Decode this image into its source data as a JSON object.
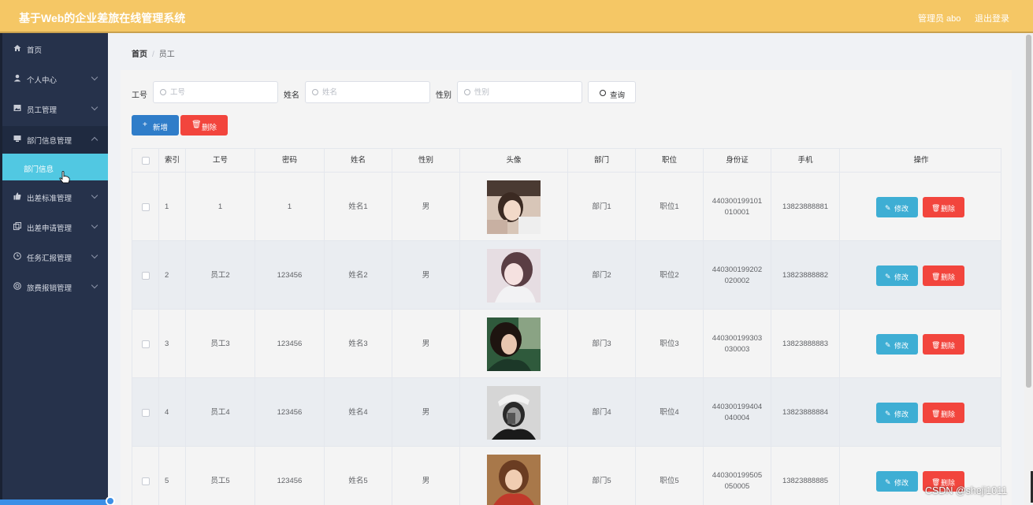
{
  "header": {
    "title": "基于Web的企业差旅在线管理系统",
    "user": "管理员 abo",
    "logout": "退出登录"
  },
  "sidebar": {
    "items": [
      {
        "label": "首页",
        "icon": "home-icon"
      },
      {
        "label": "个人中心",
        "icon": "user-icon"
      },
      {
        "label": "员工管理",
        "icon": "image-icon"
      },
      {
        "label": "部门信息管理",
        "icon": "monitor-icon"
      },
      {
        "label": "出差标准管理",
        "icon": "thumb-icon"
      },
      {
        "label": "出差申请管理",
        "icon": "copy-icon"
      },
      {
        "label": "任务汇报管理",
        "icon": "clock-icon"
      },
      {
        "label": "旅费报销管理",
        "icon": "circle-icon"
      }
    ],
    "active_sub": "部门信息"
  },
  "breadcrumb": {
    "home": "首页",
    "separator": "/",
    "current": "员工"
  },
  "search": {
    "job_no_label": "工号",
    "job_no_placeholder": "工号",
    "name_label": "姓名",
    "name_placeholder": "姓名",
    "gender_label": "性别",
    "gender_placeholder": "性别",
    "button": "查询"
  },
  "actions": {
    "add": "新增",
    "delete": "删除"
  },
  "table": {
    "columns": [
      "索引",
      "工号",
      "密码",
      "姓名",
      "性别",
      "头像",
      "部门",
      "职位",
      "身份证",
      "手机",
      "操作"
    ],
    "rows": [
      {
        "index": "1",
        "job_no": "1",
        "password": "1",
        "name": "姓名1",
        "gender": "男",
        "dept": "部门1",
        "position": "职位1",
        "id_line1": "440300199101",
        "id_line2": "010001",
        "phone": "13823888881"
      },
      {
        "index": "2",
        "job_no": "员工2",
        "password": "123456",
        "name": "姓名2",
        "gender": "男",
        "dept": "部门2",
        "position": "职位2",
        "id_line1": "440300199202",
        "id_line2": "020002",
        "phone": "13823888882"
      },
      {
        "index": "3",
        "job_no": "员工3",
        "password": "123456",
        "name": "姓名3",
        "gender": "男",
        "dept": "部门3",
        "position": "职位3",
        "id_line1": "440300199303",
        "id_line2": "030003",
        "phone": "13823888883"
      },
      {
        "index": "4",
        "job_no": "员工4",
        "password": "123456",
        "name": "姓名4",
        "gender": "男",
        "dept": "部门4",
        "position": "职位4",
        "id_line1": "440300199404",
        "id_line2": "040004",
        "phone": "13823888884"
      },
      {
        "index": "5",
        "job_no": "员工5",
        "password": "123456",
        "name": "姓名5",
        "gender": "男",
        "dept": "部门5",
        "position": "职位5",
        "id_line1": "440300199505",
        "id_line2": "050005",
        "phone": "13823888885"
      }
    ],
    "edit_label": "修改",
    "delete_label": "删除"
  },
  "watermark": "CSDN @sheji1011",
  "colors": {
    "header": "#f5c765",
    "sidebar": "#26324b",
    "active_submenu": "#51c8e2",
    "primary": "#2f7dc9",
    "danger": "#f2453d",
    "edit": "#3eaed4"
  }
}
